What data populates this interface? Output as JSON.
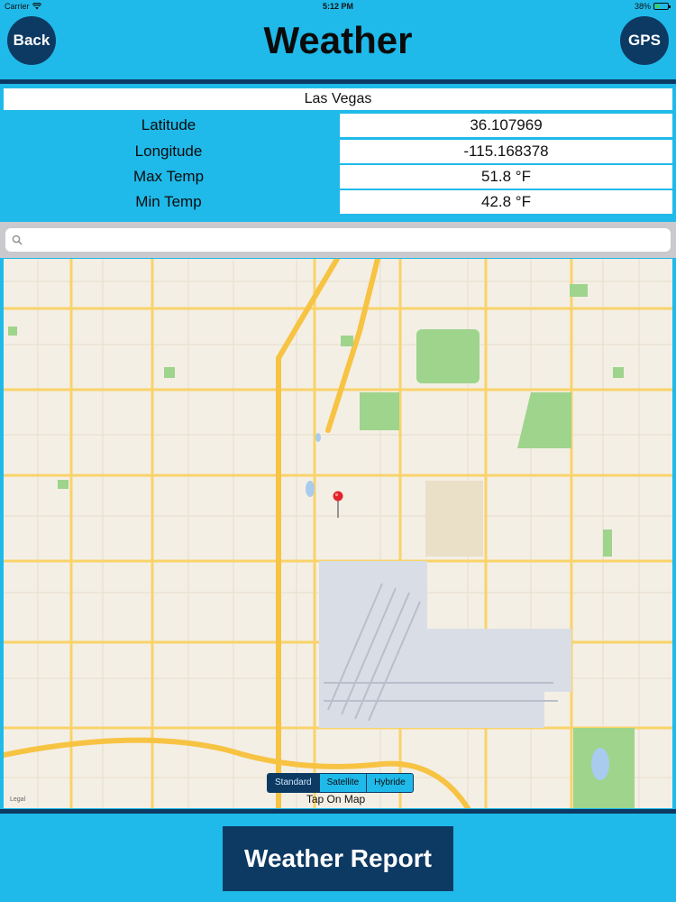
{
  "status_bar": {
    "carrier": "Carrier",
    "time": "5:12 PM",
    "battery": "38%",
    "battery_level": 0.38
  },
  "header": {
    "back_label": "Back",
    "title": "Weather",
    "gps_label": "GPS"
  },
  "info": {
    "city": "Las Vegas",
    "rows": [
      {
        "label": "Latitude",
        "value": "36.107969"
      },
      {
        "label": "Longitude",
        "value": "-115.168378"
      },
      {
        "label": "Max Temp",
        "value": "51.8 °F"
      },
      {
        "label": "Min Temp",
        "value": "42.8 °F"
      }
    ]
  },
  "search": {
    "placeholder": "",
    "value": ""
  },
  "map": {
    "map_types": [
      "Standard",
      "Satellite",
      "Hybride"
    ],
    "selected_map_type": "Standard",
    "hint": "Tap On Map",
    "legal": "Legal"
  },
  "footer": {
    "report_label": "Weather Report"
  },
  "colors": {
    "background": "#1fbaea",
    "navy": "#0d3a63",
    "road": "#f9d36a",
    "park": "#9ed48c",
    "airport": "#d9dde6"
  }
}
